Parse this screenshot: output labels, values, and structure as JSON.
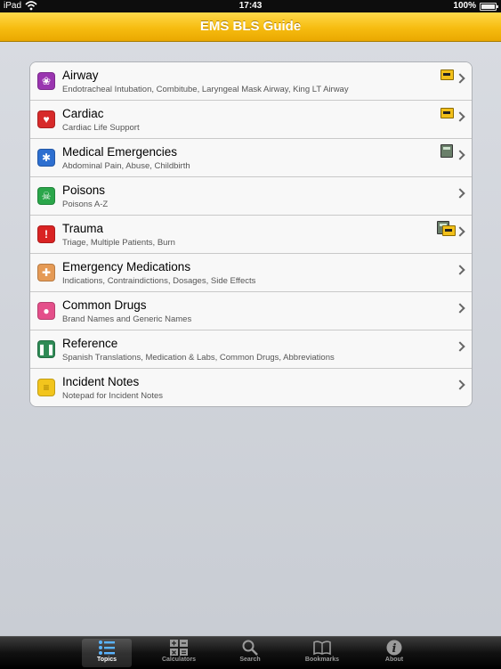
{
  "status_bar": {
    "carrier": "iPad",
    "time": "17:43",
    "battery": "100%"
  },
  "nav": {
    "title": "EMS BLS Guide"
  },
  "topics": [
    {
      "title": "Airway",
      "subtitle": "Endotracheal Intubation, Combitube, Laryngeal Mask Airway, King LT Airway",
      "icon": "lungs-icon",
      "icon_color": "#9a35b0",
      "badges": [
        "bookmark-icon"
      ]
    },
    {
      "title": "Cardiac",
      "subtitle": "Cardiac Life Support",
      "icon": "heart-icon",
      "icon_color": "#d72a2a",
      "badges": [
        "bookmark-icon"
      ]
    },
    {
      "title": "Medical Emergencies",
      "subtitle": "Abdominal Pain, Abuse, Childbirth",
      "icon": "star-of-life-icon",
      "icon_color": "#2d6fd0",
      "badges": [
        "calculator-icon"
      ]
    },
    {
      "title": "Poisons",
      "subtitle": "Poisons A-Z",
      "icon": "skull-crossbones-icon",
      "icon_color": "#2aa64a",
      "badges": []
    },
    {
      "title": "Trauma",
      "subtitle": "Triage, Multiple Patients, Burn",
      "icon": "warning-icon",
      "icon_color": "#d92323",
      "badges": [
        "calculator-icon",
        "bookmark-icon"
      ]
    },
    {
      "title": "Emergency Medications",
      "subtitle": "Indications, Contraindictions, Dosages, Side Effects",
      "icon": "medication-icon",
      "icon_color": "#e59a55",
      "badges": []
    },
    {
      "title": "Common Drugs",
      "subtitle": "Brand Names and Generic Names",
      "icon": "pills-icon",
      "icon_color": "#e44f8a",
      "badges": []
    },
    {
      "title": "Reference",
      "subtitle": "Spanish Translations, Medication & Labs, Common Drugs, Abbreviations",
      "icon": "books-icon",
      "icon_color": "#2e8a55",
      "badges": []
    },
    {
      "title": "Incident Notes",
      "subtitle": "Notepad for Incident Notes",
      "icon": "notepad-icon",
      "icon_color": "#f2c51d",
      "badges": []
    }
  ],
  "tab_bar": {
    "tabs": [
      {
        "label": "Topics",
        "icon": "list-icon",
        "selected": true
      },
      {
        "label": "Calculators",
        "icon": "calculator-icon",
        "selected": false
      },
      {
        "label": "Search",
        "icon": "search-icon",
        "selected": false
      },
      {
        "label": "Bookmarks",
        "icon": "book-icon",
        "selected": false
      },
      {
        "label": "About",
        "icon": "info-icon",
        "selected": false
      }
    ]
  }
}
